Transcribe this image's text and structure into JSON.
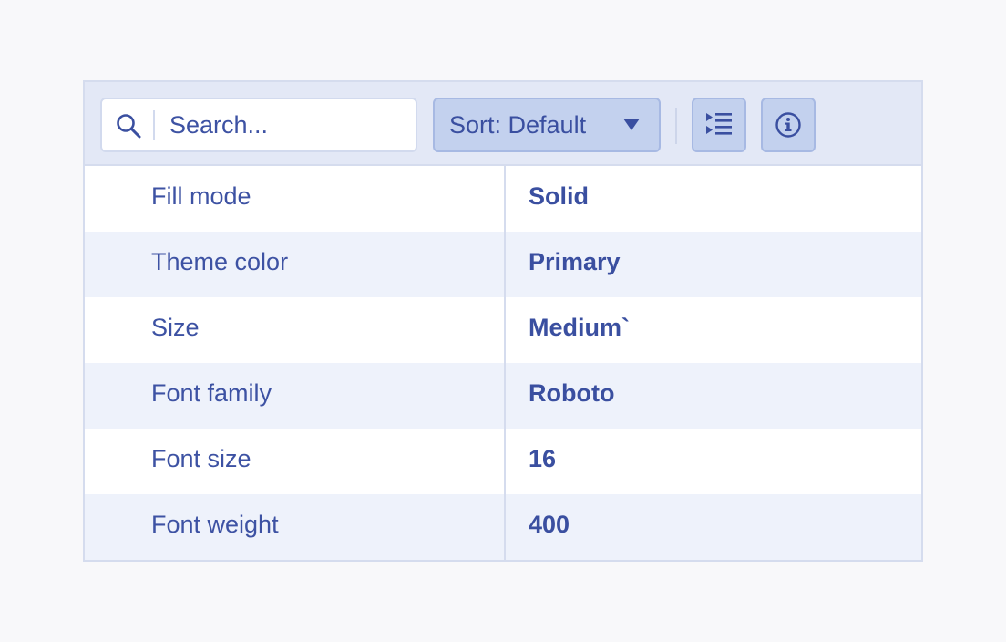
{
  "toolbar": {
    "search": {
      "placeholder": "Search...",
      "value": ""
    },
    "sort": {
      "label": "Sort: Default"
    },
    "icons": {
      "search": "search-icon",
      "sort_caret": "caret-down-icon",
      "expand": "expand-all-icon",
      "info": "info-icon"
    }
  },
  "rows": [
    {
      "name": "Fill mode",
      "value": "Solid"
    },
    {
      "name": "Theme color",
      "value": "Primary"
    },
    {
      "name": "Size",
      "value": "Medium`"
    },
    {
      "name": "Font family",
      "value": "Roboto"
    },
    {
      "name": "Font size",
      "value": "16"
    },
    {
      "name": "Font weight",
      "value": "400"
    }
  ],
  "colors": {
    "accent": "#3a4fa0",
    "toolbar_bg": "#e3e8f6",
    "button_bg": "#c3d1ee",
    "alt_row_bg": "#eef2fb",
    "border": "#d5dcee"
  }
}
